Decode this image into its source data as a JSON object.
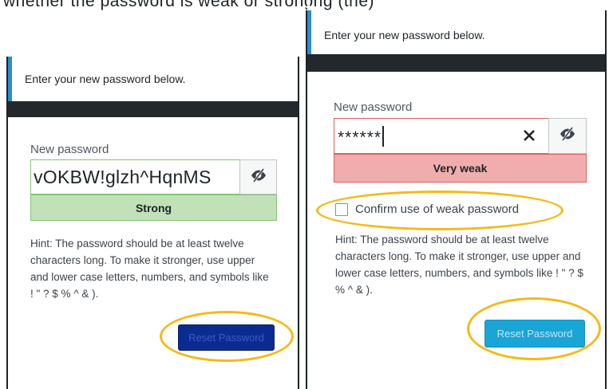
{
  "caption_fragment": "whether the password is weak or strong (the)",
  "left_panel": {
    "notice": "Enter your new password below.",
    "new_password_label": "New password",
    "password_value": "vOKBW!glzh^HqnMS",
    "strength_label": "Strong",
    "hint": "Hint: The password should be at least twelve characters long. To make it stronger, use upper and lower case letters, numbers, and symbols like ! \" ? $ % ^ & ).",
    "reset_button": "Reset Password"
  },
  "right_panel": {
    "notice": "Enter your new password below.",
    "new_password_label": "New password",
    "password_value": "******",
    "strength_label": "Very weak",
    "confirm_weak_label": "Confirm use of weak password",
    "hint": "Hint: The password should be at least twelve characters long. To make it stronger, use upper and lower case letters, numbers, and symbols like ! \" ? $ % ^ & ).",
    "reset_button": "Reset Password"
  },
  "icons": {
    "visibility_toggle": "eye-slash-icon",
    "clear_input": "close-icon"
  },
  "colors": {
    "accent_blue": "#2a8dcc",
    "strong_bg": "#c1e1b9",
    "strong_border": "#83c373",
    "weak_bg": "#f1adad",
    "weak_border": "#e35b5b",
    "reset_dark": "#0a2c90",
    "reset_dark_text": "#3c5ac8",
    "reset_light": "#1ba4d6",
    "reset_light_text": "#bfe6f7",
    "highlight": "#f5b918"
  }
}
